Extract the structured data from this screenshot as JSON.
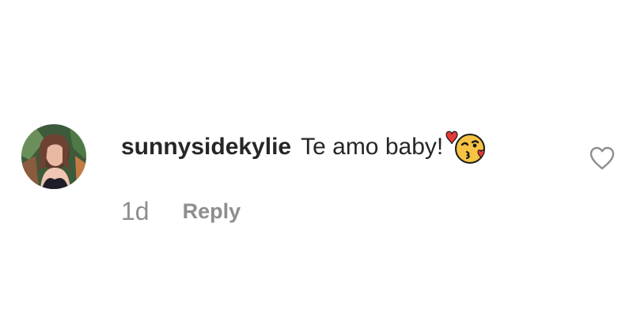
{
  "comment": {
    "username": "sunnysidekylie",
    "text": "Te amo baby!",
    "emoji": "kissing-face-with-heart-emoji",
    "timestamp": "1d",
    "reply_label": "Reply"
  },
  "icons": {
    "avatar": "profile-photo",
    "like": "heart-outline-icon"
  },
  "colors": {
    "text": "#262626",
    "secondary": "#8e8e8e",
    "heart_outline": "#8e8e8e"
  }
}
